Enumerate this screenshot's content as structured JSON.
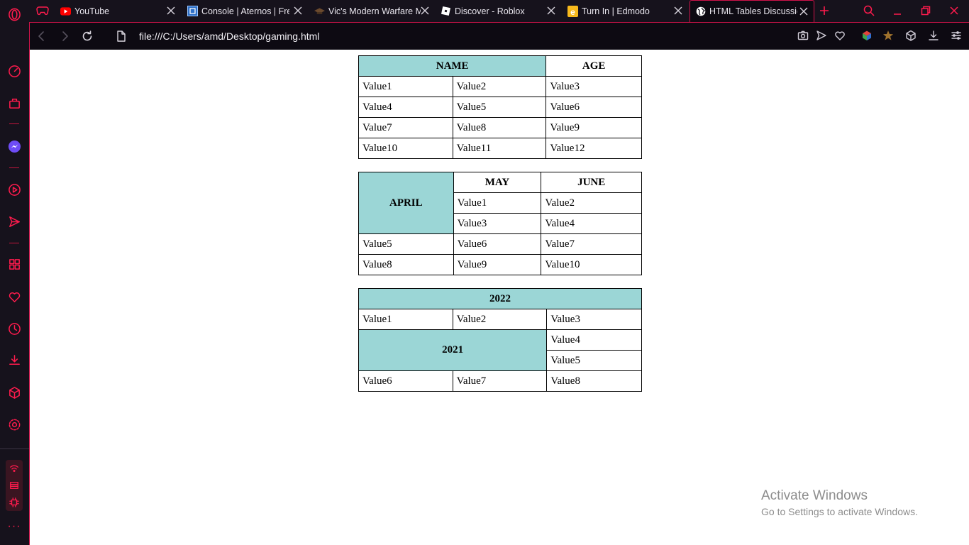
{
  "tabs": [
    {
      "title": "YouTube",
      "icon": "youtube-icon",
      "active": false
    },
    {
      "title": "Console | Aternos | Free",
      "icon": "aternos-icon",
      "active": false
    },
    {
      "title": "Vic's Modern Warfare M",
      "icon": "hat-icon",
      "active": false
    },
    {
      "title": "Discover - Roblox",
      "icon": "roblox-icon",
      "active": false
    },
    {
      "title": "Turn In | Edmodo",
      "icon": "edmodo-icon",
      "active": false
    },
    {
      "title": "HTML Tables Discussion",
      "icon": "globe-icon",
      "active": true
    }
  ],
  "address": {
    "url": "file:///C:/Users/amd/Desktop/gaming.html"
  },
  "colors": {
    "accent": "#ff1b4d",
    "highlight_cell": "#9bd6d6",
    "chrome_bg": "#16121c"
  },
  "tables": {
    "t1": {
      "header": [
        "NAME",
        "AGE"
      ],
      "rows": [
        [
          "Value1",
          "Value2",
          "Value3"
        ],
        [
          "Value4",
          "Value5",
          "Value6"
        ],
        [
          "Value7",
          "Value8",
          "Value9"
        ],
        [
          "Value10",
          "Value11",
          "Value12"
        ]
      ]
    },
    "t2": {
      "april": "APRIL",
      "may": "MAY",
      "june": "JUNE",
      "r1": [
        "Value1",
        "Value2"
      ],
      "r2": [
        "Value3",
        "Value4"
      ],
      "r3": [
        "Value5",
        "Value6",
        "Value7"
      ],
      "r4": [
        "Value8",
        "Value9",
        "Value10"
      ]
    },
    "t3": {
      "year_top": "2022",
      "r1": [
        "Value1",
        "Value2",
        "Value3"
      ],
      "year_mid": "2021",
      "r2": [
        "Value4"
      ],
      "r3": [
        "Value5"
      ],
      "r4": [
        "Value6",
        "Value7",
        "Value8"
      ]
    }
  },
  "watermark": {
    "line1": "Activate Windows",
    "line2": "Go to Settings to activate Windows."
  },
  "sidebar_icons": [
    "opera-logo-icon",
    "speed-dial-icon",
    "shopping-bag-icon",
    "messenger-icon",
    "player-icon",
    "send-icon",
    "apps-icon",
    "heart-icon",
    "history-icon",
    "download-icon",
    "cube-icon",
    "settings-icon",
    "more-icon"
  ]
}
